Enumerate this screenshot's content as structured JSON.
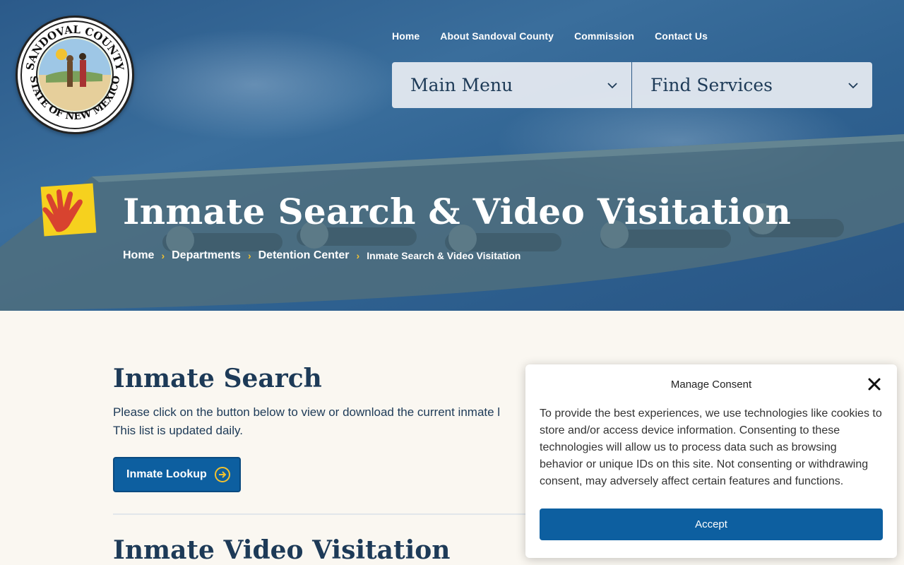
{
  "header": {
    "logo_text_top": "SANDOVAL COUNTY",
    "logo_text_bottom": "STATE OF NEW MEXICO",
    "nav": [
      {
        "label": "Home"
      },
      {
        "label": "About Sandoval County"
      },
      {
        "label": "Commission"
      },
      {
        "label": "Contact Us"
      }
    ],
    "main_menu_label": "Main Menu",
    "find_services_label": "Find Services"
  },
  "hero": {
    "title": "Inmate Search & Video Visitation",
    "breadcrumb": [
      {
        "label": "Home"
      },
      {
        "label": "Departments"
      },
      {
        "label": "Detention Center"
      },
      {
        "label": "Inmate Search & Video Visitation"
      }
    ],
    "separator": "›"
  },
  "main": {
    "inmate_search_heading": "Inmate Search",
    "inmate_search_text_line1": "Please click on the button below to view or download the current inmate l",
    "inmate_search_text_line2": "This list is updated daily.",
    "lookup_button_label": "Inmate Lookup",
    "video_visitation_heading": "Inmate Video Visitation"
  },
  "consent": {
    "title": "Manage Consent",
    "body": "To provide the best experiences, we use technologies like cookies to store and/or access device information. Consenting to these technologies will allow us to process data such as browsing behavior or unique IDs on this site. Not consenting or withdrawing consent, may adversely affect certain features and functions.",
    "accept_label": "Accept"
  },
  "icons": {
    "dropdown": "chevron-down-icon",
    "lookup": "arrow-circle-right-icon",
    "close": "close-icon",
    "hand": "hand-logo-icon"
  },
  "colors": {
    "primary": "#0d5fa0",
    "accent": "#f2c230",
    "heading": "#1d3a57",
    "background": "#faf7f1"
  }
}
